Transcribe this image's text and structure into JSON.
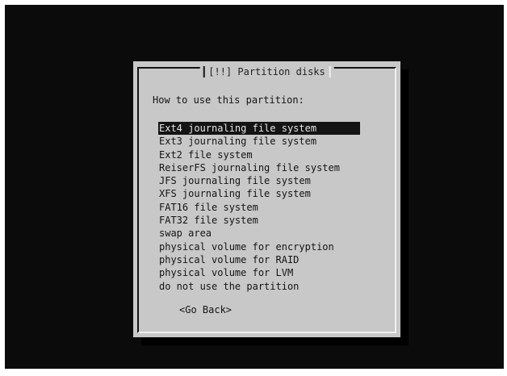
{
  "colors": {
    "screen_background": "#0b0b0b",
    "dialog_background": "#c8c8c8",
    "text": "#141414",
    "highlight_background": "#141414",
    "highlight_text": "#e6e6e6"
  },
  "dialog": {
    "title": "[!!] Partition disks",
    "prompt": "How to use this partition:",
    "selected_index": 0,
    "options": [
      "Ext4 journaling file system",
      "Ext3 journaling file system",
      "Ext2 file system",
      "ReiserFS journaling file system",
      "JFS journaling file system",
      "XFS journaling file system",
      "FAT16 file system",
      "FAT32 file system",
      "swap area",
      "physical volume for encryption",
      "physical volume for RAID",
      "physical volume for LVM",
      "do not use the partition"
    ],
    "back_button": "<Go Back>"
  }
}
